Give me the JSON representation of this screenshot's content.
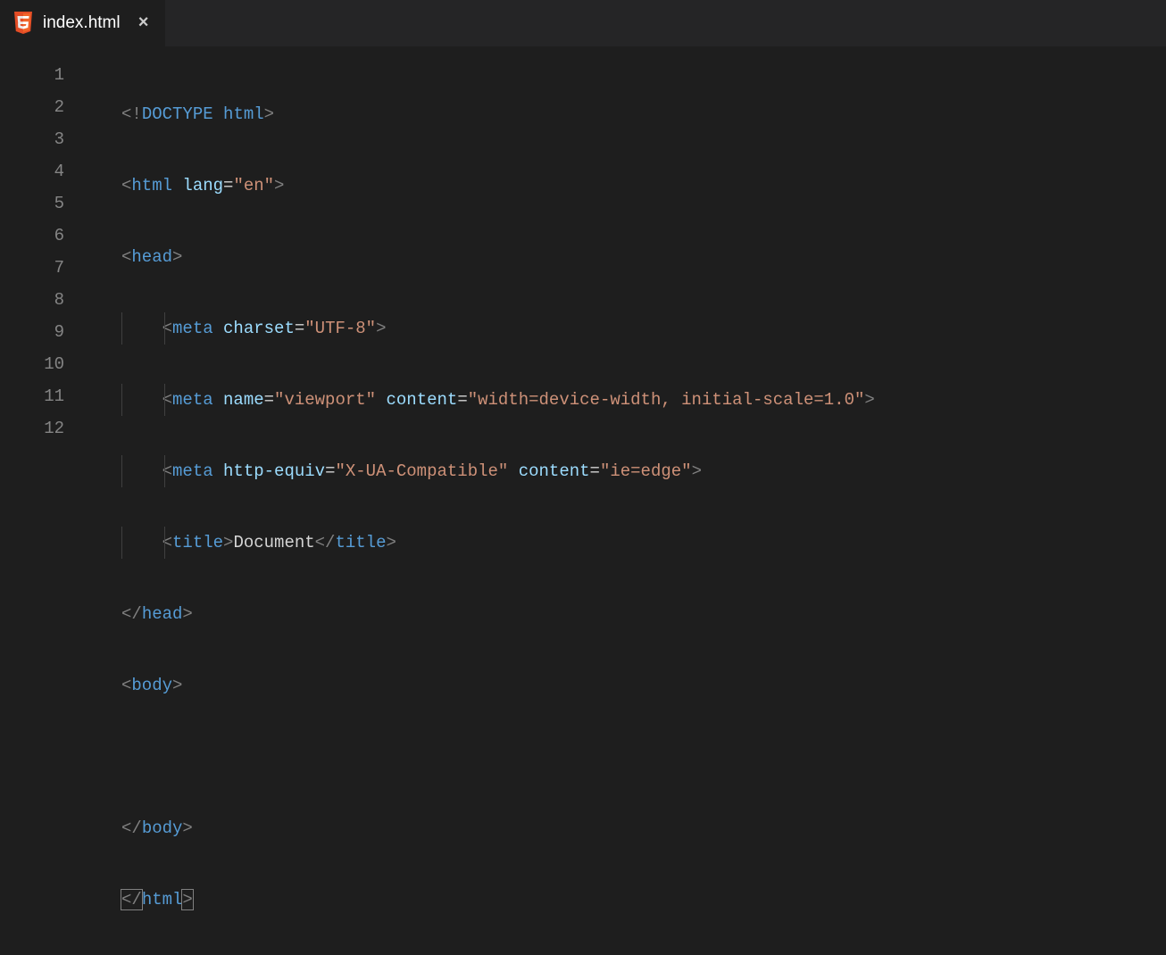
{
  "tab": {
    "filename": "index.html",
    "icon": "html5-icon",
    "close_label": "×"
  },
  "gutter": {
    "lines": [
      "1",
      "2",
      "3",
      "4",
      "5",
      "6",
      "7",
      "8",
      "9",
      "10",
      "11",
      "12"
    ]
  },
  "code": {
    "line1": {
      "open": "<!",
      "doctype": "DOCTYPE",
      "space": " ",
      "html": "html",
      "close": ">"
    },
    "line2": {
      "lt": "<",
      "tag": "html",
      "attr": "lang",
      "eq": "=",
      "val": "\"en\"",
      "gt": ">"
    },
    "line3": {
      "lt": "<",
      "tag": "head",
      "gt": ">"
    },
    "line4": {
      "lt": "<",
      "tag": "meta",
      "attr": "charset",
      "eq": "=",
      "val": "\"UTF-8\"",
      "gt": ">"
    },
    "line5": {
      "lt": "<",
      "tag": "meta",
      "attr1": "name",
      "eq1": "=",
      "val1": "\"viewport\"",
      "attr2": "content",
      "eq2": "=",
      "val2": "\"width=device-width, initial-scale=1.0\"",
      "gt": ">"
    },
    "line6": {
      "lt": "<",
      "tag": "meta",
      "attr1": "http-equiv",
      "eq1": "=",
      "val1": "\"X-UA-Compatible\"",
      "attr2": "content",
      "eq2": "=",
      "val2": "\"ie=edge\"",
      "gt": ">"
    },
    "line7": {
      "lt": "<",
      "tag": "title",
      "gt": ">",
      "text": "Document",
      "lt2": "</",
      "tag2": "title",
      "gt2": ">"
    },
    "line8": {
      "lt": "</",
      "tag": "head",
      "gt": ">"
    },
    "line9": {
      "lt": "<",
      "tag": "body",
      "gt": ">"
    },
    "line10": {
      "blank": ""
    },
    "line11": {
      "lt": "</",
      "tag": "body",
      "gt": ">"
    },
    "line12": {
      "lt": "</",
      "tag": "html",
      "gt": ">"
    }
  }
}
